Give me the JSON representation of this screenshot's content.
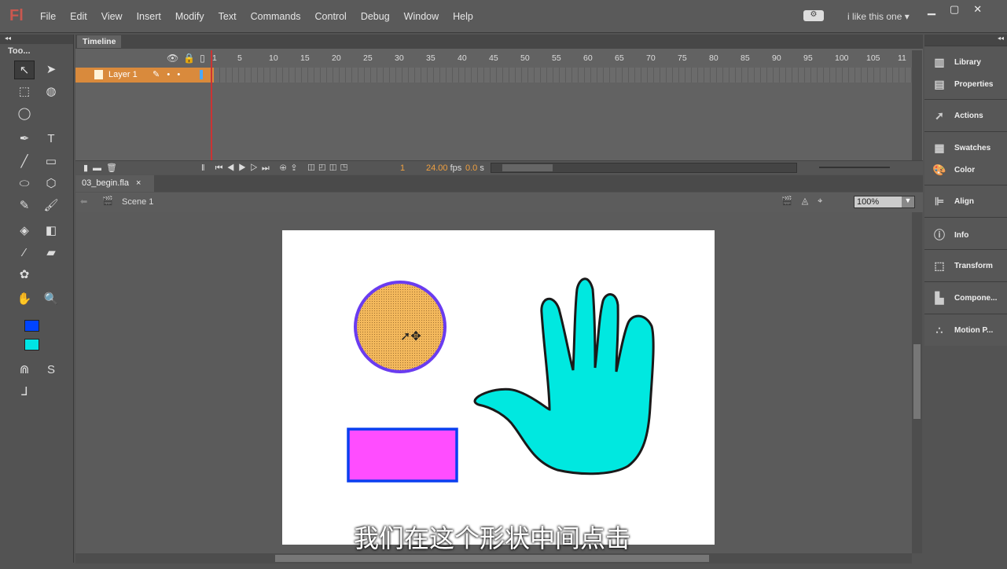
{
  "app": {
    "logo": "Fl",
    "workspace": "i like this one"
  },
  "menu": [
    "File",
    "Edit",
    "View",
    "Insert",
    "Modify",
    "Text",
    "Commands",
    "Control",
    "Debug",
    "Window",
    "Help"
  ],
  "tools": {
    "title": "Too...",
    "stroke_color": "#0044ff",
    "fill_color": "#00e5e5"
  },
  "timeline": {
    "tab": "Timeline",
    "layer": "Layer 1",
    "ticks": [
      "1",
      "5",
      "10",
      "15",
      "20",
      "25",
      "30",
      "35",
      "40",
      "45",
      "50",
      "55",
      "60",
      "65",
      "70",
      "75",
      "80",
      "85",
      "90",
      "95",
      "100",
      "105",
      "11"
    ],
    "frame": "1",
    "fps": "24.00",
    "fps_unit": "fps",
    "time": "0.0",
    "time_unit": "s"
  },
  "document": {
    "tab": "03_begin.fla",
    "close": "×",
    "scene": "Scene 1",
    "zoom": "100%"
  },
  "panels": [
    {
      "label": "Library",
      "icon": "library-icon"
    },
    {
      "label": "Properties",
      "icon": "properties-icon"
    },
    {
      "label": "Actions",
      "icon": "actions-icon"
    },
    {
      "label": "Swatches",
      "icon": "swatches-icon"
    },
    {
      "label": "Color",
      "icon": "color-icon"
    },
    {
      "label": "Align",
      "icon": "align-icon"
    },
    {
      "label": "Info",
      "icon": "info-icon"
    },
    {
      "label": "Transform",
      "icon": "transform-icon"
    },
    {
      "label": "Compone...",
      "icon": "components-icon"
    },
    {
      "label": "Motion P...",
      "icon": "motion-presets-icon"
    }
  ],
  "stage": {
    "circle_fill": "#f3b85c",
    "circle_stroke": "#6a3cf0",
    "rect_fill": "#ff4dff",
    "rect_stroke": "#0a3ff0",
    "hand_fill": "#00e8e0"
  },
  "subtitle": "我们在这个形状中间点击"
}
